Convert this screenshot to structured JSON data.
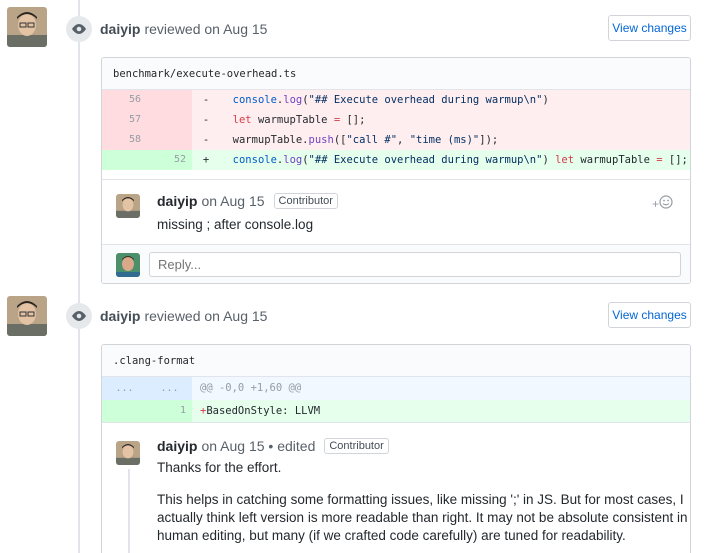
{
  "reviews": [
    {
      "author": "daiyip",
      "action_text": "reviewed on Aug 15",
      "view_changes": "View changes",
      "file": "benchmark/execute-overhead.ts",
      "diff": [
        {
          "type": "del",
          "old": "56",
          "new": "",
          "sign": "-",
          "code": "  console.log(\"## Execute overhead during warmup\\n\")"
        },
        {
          "type": "del",
          "old": "57",
          "new": "",
          "sign": "-",
          "code": "  let warmupTable = [];"
        },
        {
          "type": "del",
          "old": "58",
          "new": "",
          "sign": "-",
          "code": "  warmupTable.push([\"call #\", \"time (ms)\"]);"
        },
        {
          "type": "add",
          "old": "",
          "new": "52",
          "sign": "+",
          "code": "  console.log(\"## Execute overhead during warmup\\n\") let warmupTable = [];"
        }
      ],
      "comment": {
        "author": "daiyip",
        "date": "on Aug 15",
        "badge": "Contributor",
        "reaction": "+☺",
        "body": "missing ; after console.log"
      },
      "reply_placeholder": "Reply..."
    },
    {
      "author": "daiyip",
      "action_text": "reviewed on Aug 15",
      "view_changes": "View changes",
      "file": ".clang-format",
      "diff": [
        {
          "type": "hunk",
          "old": "...",
          "new": "...",
          "sign": "",
          "code": "@@ -0,0 +1,60 @@"
        },
        {
          "type": "add",
          "old": "",
          "new": "1",
          "sign": "",
          "code": "+BasedOnStyle: LLVM"
        }
      ],
      "comment": {
        "author": "daiyip",
        "date": "on Aug 15 • edited",
        "badge": "Contributor",
        "body_line1": "Thanks for the effort.",
        "body_p2_l1": "This helps in catching some formatting issues, like missing ';' in JS. But for most cases, I",
        "body_p2_l2": "actually think left version is more readable than right. It may not be absolute consistent in",
        "body_p2_l3": "human editing, but many (if we crafted code carefully) are tuned for readability."
      }
    }
  ],
  "colors": {
    "link": "#0366d6",
    "del_bg": "#ffeef0",
    "add_bg": "#e6ffed",
    "hunk_bg": "#f1f8ff"
  },
  "icons": [
    "eye-icon",
    "smiley-icon",
    "avatar-daiyip",
    "avatar-current-user"
  ]
}
